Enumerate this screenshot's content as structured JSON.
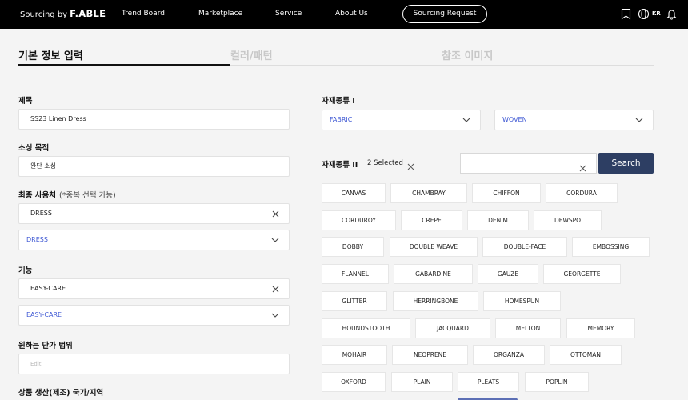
{
  "nav": {
    "brand_prefix": "Sourcing by",
    "brand_name": "F.ABLE",
    "items": [
      "Trend Board",
      "Marketplace",
      "Service",
      "About Us"
    ],
    "cta": "Sourcing Request",
    "lang": "KR",
    "icons": [
      "bookmark-icon",
      "globe-icon",
      "bell-icon"
    ]
  },
  "tabs": [
    "기본 정보 입력",
    "컬러/패턴",
    "참조 이미지"
  ],
  "left": {
    "title_label": "제목",
    "title_value": "SS23 Linen Dress",
    "purpose_label": "소싱 목적",
    "purpose_value": "완단 소싱",
    "end_user_label": "최종 사용처",
    "end_user_note": "(*중복 선택 가능)",
    "end_user_chip": "DRESS",
    "end_user_select": "DRESS",
    "function_label": "기능",
    "function_chip": "EASY-CARE",
    "function_select": "EASY-CARE",
    "price_label": "원하는 단가 범위",
    "price_placeholder": "Edit",
    "country_label": "상품 생산(제조) 국가/지역"
  },
  "right": {
    "material1_label": "자재종류 I",
    "material1_select": "FABRIC",
    "material1b_select": "WOVEN",
    "material2_label": "자재종류 II",
    "selected_count": "2 Selected",
    "search_value": "",
    "search_button": "Search",
    "chips": [
      "CANVAS",
      "CHAMBRAY",
      "CHIFFON",
      "CORDURA",
      "CORDUROY",
      "CREPE",
      "DENIM",
      "DEWSPO",
      "DOBBY",
      "DOUBLE WEAVE",
      "DOUBLE-FACE",
      "EMBOSSING",
      "FLANNEL",
      "GABARDINE",
      "GAUZE",
      "GEORGETTE",
      "GLITTER",
      "HERRINGBONE",
      "HOMESPUN",
      "HOUNDSTOOTH",
      "JACQUARD",
      "MELTON",
      "MEMORY",
      "MOHAIR",
      "NEOPRENE",
      "ORGANZA",
      "OTTOMAN",
      "OXFORD",
      "PLAIN",
      "PLEATS",
      "POPLIN"
    ]
  },
  "colors": {
    "nav_bg": "#000000",
    "accent_blue": "#3f59d4",
    "search_btn": "#2d3e63",
    "page_bg": "#f4f4f4"
  }
}
